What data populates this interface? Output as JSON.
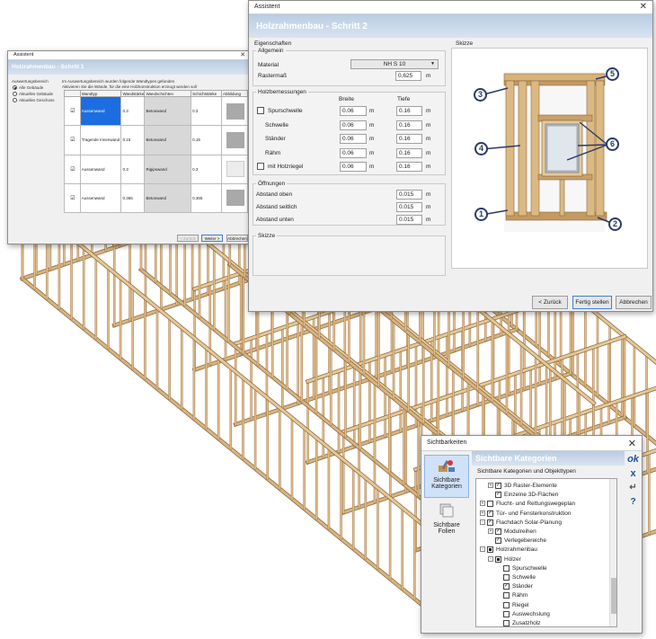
{
  "wizard_step1": {
    "window_title": "Assistent",
    "header": "Holzrahmenbau - Schritt 1",
    "scope_label": "Auswertungsbereich",
    "scope_options": [
      "Alle Gebäude",
      "Aktuelles Gebäude",
      "Aktuelles Geschoss"
    ],
    "selected_scope": "Alle Gebäude",
    "info_line1": "Im Auswertungsbereich wurden folgende Wandtypen gefunden",
    "info_line2": "Aktivieren Sie die Wände, für die eine Holzkonstruktion erzeugt werden soll",
    "columns": [
      "",
      "Wandtyp",
      "Wandstärke",
      "Wandschichten",
      "Schichtstärke",
      "Abbildung"
    ],
    "rows": [
      {
        "checked": true,
        "type": "Aussenwand",
        "thickness": "0.3",
        "layer": "Betonwand",
        "layer_thickness": "0.3"
      },
      {
        "checked": true,
        "type": "Tragende Innenwand",
        "thickness": "0.15",
        "layer": "Betonwand",
        "layer_thickness": "0.15"
      },
      {
        "checked": true,
        "type": "Aussenwand",
        "thickness": "0.3",
        "layer": "Rigipswand",
        "layer_thickness": "0.3"
      },
      {
        "checked": true,
        "type": "Aussenwand",
        "thickness": "0.365",
        "layer": "Betonwand",
        "layer_thickness": "0.365"
      }
    ],
    "buttons": {
      "back": "< Zurück",
      "next": "Weiter >",
      "cancel": "Abbrechen"
    }
  },
  "wizard_step2": {
    "window_title": "Assistent",
    "header": "Holzrahmenbau - Schritt 2",
    "properties_title": "Eigenschaften",
    "general_title": "Allgemein",
    "material_label": "Material",
    "material_value": "NH S 10",
    "grid_label": "Rastermaß",
    "grid_value": "0,625",
    "unit_m": "m",
    "timber_title": "Holzbemessungen",
    "col_width": "Breite",
    "col_depth": "Tiefe",
    "timber_rows": [
      {
        "label": "Spurschwelle",
        "has_checkbox": true,
        "width": "0.06",
        "depth": "0.16"
      },
      {
        "label": "Schwelle",
        "has_checkbox": false,
        "width": "0.06",
        "depth": "0.16"
      },
      {
        "label": "Ständer",
        "has_checkbox": false,
        "width": "0.06",
        "depth": "0.16"
      },
      {
        "label": "Rähm",
        "has_checkbox": false,
        "width": "0.06",
        "depth": "0.16"
      },
      {
        "label": "mit Holzriegel",
        "has_checkbox": true,
        "width": "0.06",
        "depth": "0.16"
      }
    ],
    "openings_title": "Öffnungen",
    "openings_rows": [
      {
        "label": "Abstand oben",
        "value": "0.015"
      },
      {
        "label": "Abstand seitlich",
        "value": "0.015"
      },
      {
        "label": "Abstand unten",
        "value": "0.015"
      }
    ],
    "sketch_group_title": "Skizze",
    "sketch_panel_title": "Skizze",
    "callouts": [
      "1",
      "2",
      "3",
      "4",
      "5",
      "6"
    ],
    "buttons": {
      "back": "< Zurück",
      "finish": "Fertig stellen",
      "cancel": "Abbrechen"
    }
  },
  "visibility": {
    "window_title": "Sichtbarkeiten",
    "side_items": [
      {
        "label": "Sichtbare Kategorien",
        "active": true,
        "icon": "category-tools-icon"
      },
      {
        "label": "Sichtbare Folien",
        "active": false,
        "icon": "layers-icon"
      }
    ],
    "panel_title": "Sichtbare Kategorien",
    "panel_subtitle": "Sichtbare Kategorien und Objekttypen",
    "tree": [
      {
        "level": 1,
        "expander": "+",
        "check": "checked",
        "label": "3D Raster-Elemente"
      },
      {
        "level": 1,
        "expander": "",
        "check": "checked",
        "label": "Einzelne 3D-Flächen"
      },
      {
        "level": 0,
        "expander": "+",
        "check": "unchecked",
        "label": "Flucht- und Rettungswegeplan"
      },
      {
        "level": 0,
        "expander": "+",
        "check": "checked",
        "label": "Tür- und Fensterkonstruktion"
      },
      {
        "level": 0,
        "expander": "-",
        "check": "checked",
        "label": "Flachdach Solar-Planung"
      },
      {
        "level": 1,
        "expander": "+",
        "check": "checked",
        "label": "Modulreihen"
      },
      {
        "level": 1,
        "expander": "",
        "check": "checked",
        "label": "Verlegebereiche"
      },
      {
        "level": 0,
        "expander": "-",
        "check": "filled",
        "label": "Holzrahmenbau"
      },
      {
        "level": 1,
        "expander": "-",
        "check": "filled",
        "label": "Hölzer"
      },
      {
        "level": 2,
        "expander": "",
        "check": "unchecked",
        "label": "Spurschwelle"
      },
      {
        "level": 2,
        "expander": "",
        "check": "unchecked",
        "label": "Schwelle"
      },
      {
        "level": 2,
        "expander": "",
        "check": "checked",
        "label": "Ständer"
      },
      {
        "level": 2,
        "expander": "",
        "check": "unchecked",
        "label": "Rähm"
      },
      {
        "level": 2,
        "expander": "",
        "check": "unchecked",
        "label": "Riegel"
      },
      {
        "level": 2,
        "expander": "",
        "check": "unchecked",
        "label": "Auswechslung"
      },
      {
        "level": 2,
        "expander": "",
        "check": "unchecked",
        "label": "Zusatzholz"
      }
    ],
    "tool_buttons": {
      "ok": "ok",
      "close": "x",
      "enter": "↵",
      "help": "?"
    }
  }
}
